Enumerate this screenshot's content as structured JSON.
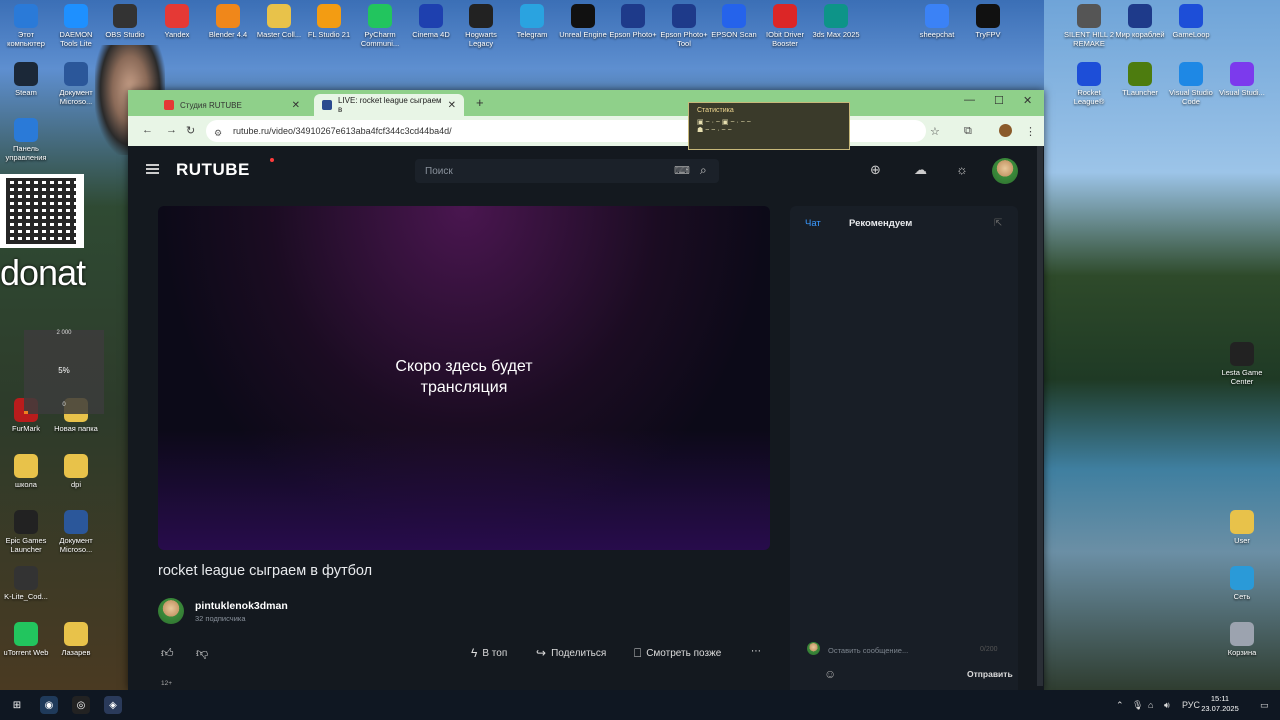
{
  "desktop": {
    "icons_top": [
      {
        "label": "Этот компьютер",
        "color": "#2a7ad8"
      },
      {
        "label": "DAEMON Tools Lite",
        "color": "#1e90ff"
      },
      {
        "label": "OBS Studio",
        "color": "#333333"
      },
      {
        "label": "Yandex",
        "color": "#e53935"
      },
      {
        "label": "Blender 4.4",
        "color": "#f0871a"
      },
      {
        "label": "Master Coll...",
        "color": "#e8c24a"
      },
      {
        "label": "FL Studio 21",
        "color": "#f39c12"
      },
      {
        "label": "PyCharm Communi...",
        "color": "#22c55e"
      },
      {
        "label": "Cinema 4D",
        "color": "#1e40af"
      },
      {
        "label": "Hogwarts Legacy",
        "color": "#222222"
      },
      {
        "label": "Telegram",
        "color": "#2aa3e0"
      },
      {
        "label": "Unreal Engine",
        "color": "#111111"
      },
      {
        "label": "Epson Photo+",
        "color": "#1e3a8a"
      },
      {
        "label": "Epson Photo+ Tool",
        "color": "#1e3a8a"
      },
      {
        "label": "EPSON Scan",
        "color": "#2563eb"
      },
      {
        "label": "IObit Driver Booster",
        "color": "#dc2626"
      },
      {
        "label": "3ds Max 2025",
        "color": "#0d9488"
      },
      {
        "label": "sheepchat",
        "color": "#3b82f6"
      },
      {
        "label": "TryFPV",
        "color": "#111111"
      },
      {
        "label": "SILENT HILL 2 REMAKE",
        "color": "#555555"
      },
      {
        "label": "Мир кораблей",
        "color": "#1e3a8a"
      },
      {
        "label": "GameLoop",
        "color": "#1d4ed8"
      }
    ],
    "icons_left": [
      {
        "label": "Steam",
        "color": "#1b2838"
      },
      {
        "label": "Документ Microso...",
        "color": "#2b579a"
      },
      {
        "label": "Панель управления",
        "color": "#2a7ad8"
      },
      {
        "label": "FurMark",
        "color": "#b91c1c"
      },
      {
        "label": "Новая папка",
        "color": "#e8c24a"
      },
      {
        "label": "школа",
        "color": "#e8c24a"
      },
      {
        "label": "dpi",
        "color": "#e8c24a"
      },
      {
        "label": "Epic Games Launcher",
        "color": "#222222"
      },
      {
        "label": "Документ Microso...",
        "color": "#2b579a"
      },
      {
        "label": "K-Lite_Cod...",
        "color": "#333333"
      },
      {
        "label": "Лазарев",
        "color": "#e8c24a"
      },
      {
        "label": "uTorrent Web",
        "color": "#22c55e"
      }
    ],
    "icons_right": [
      {
        "label": "Rocket League®",
        "color": "#1d4ed8"
      },
      {
        "label": "TLauncher",
        "color": "#4d7c0f"
      },
      {
        "label": "Visual Studio Code",
        "color": "#1e88e5"
      },
      {
        "label": "Visual Studi...",
        "color": "#7c3aed"
      },
      {
        "label": "Lesta Game Center",
        "color": "#222222"
      },
      {
        "label": "User",
        "color": "#e8c24a"
      },
      {
        "label": "Сеть",
        "color": "#2a9ad8"
      },
      {
        "label": "Корзина",
        "color": "#9ca3af"
      }
    ]
  },
  "overlays": {
    "donat": "donat",
    "gauge_top": "2 000",
    "gauge_value": "5%",
    "gauge_bottom": "0",
    "gauge_fraction": 0.05,
    "stats_title": "Статистика"
  },
  "browser": {
    "tabs": [
      {
        "label": "Студия RUTUBE"
      },
      {
        "label": "LIVE: rocket league сыграем в"
      }
    ],
    "url": "rutube.ru/video/34910267e613aba4fcf344c3cd44ba4d/"
  },
  "rutube": {
    "logo": "RUTUBE",
    "search_placeholder": "Поиск",
    "player_message": "Скоро здесь будет\nтрансляция",
    "video_title": "rocket league сыграем в футбол",
    "channel": {
      "name": "pintuklenok3dman",
      "subs": "32 подписчика"
    },
    "actions": {
      "top": "В топ",
      "share": "Поделиться",
      "later": "Смотреть позже"
    },
    "age": "12+",
    "chat": {
      "tab_chat": "Чат",
      "tab_recommend": "Рекомендуем",
      "input_placeholder": "Оставить сообщение...",
      "counter": "0/200",
      "send": "Отправить"
    }
  },
  "taskbar": {
    "lang": "РУС",
    "time": "15:11",
    "date": "23.07.2025"
  }
}
